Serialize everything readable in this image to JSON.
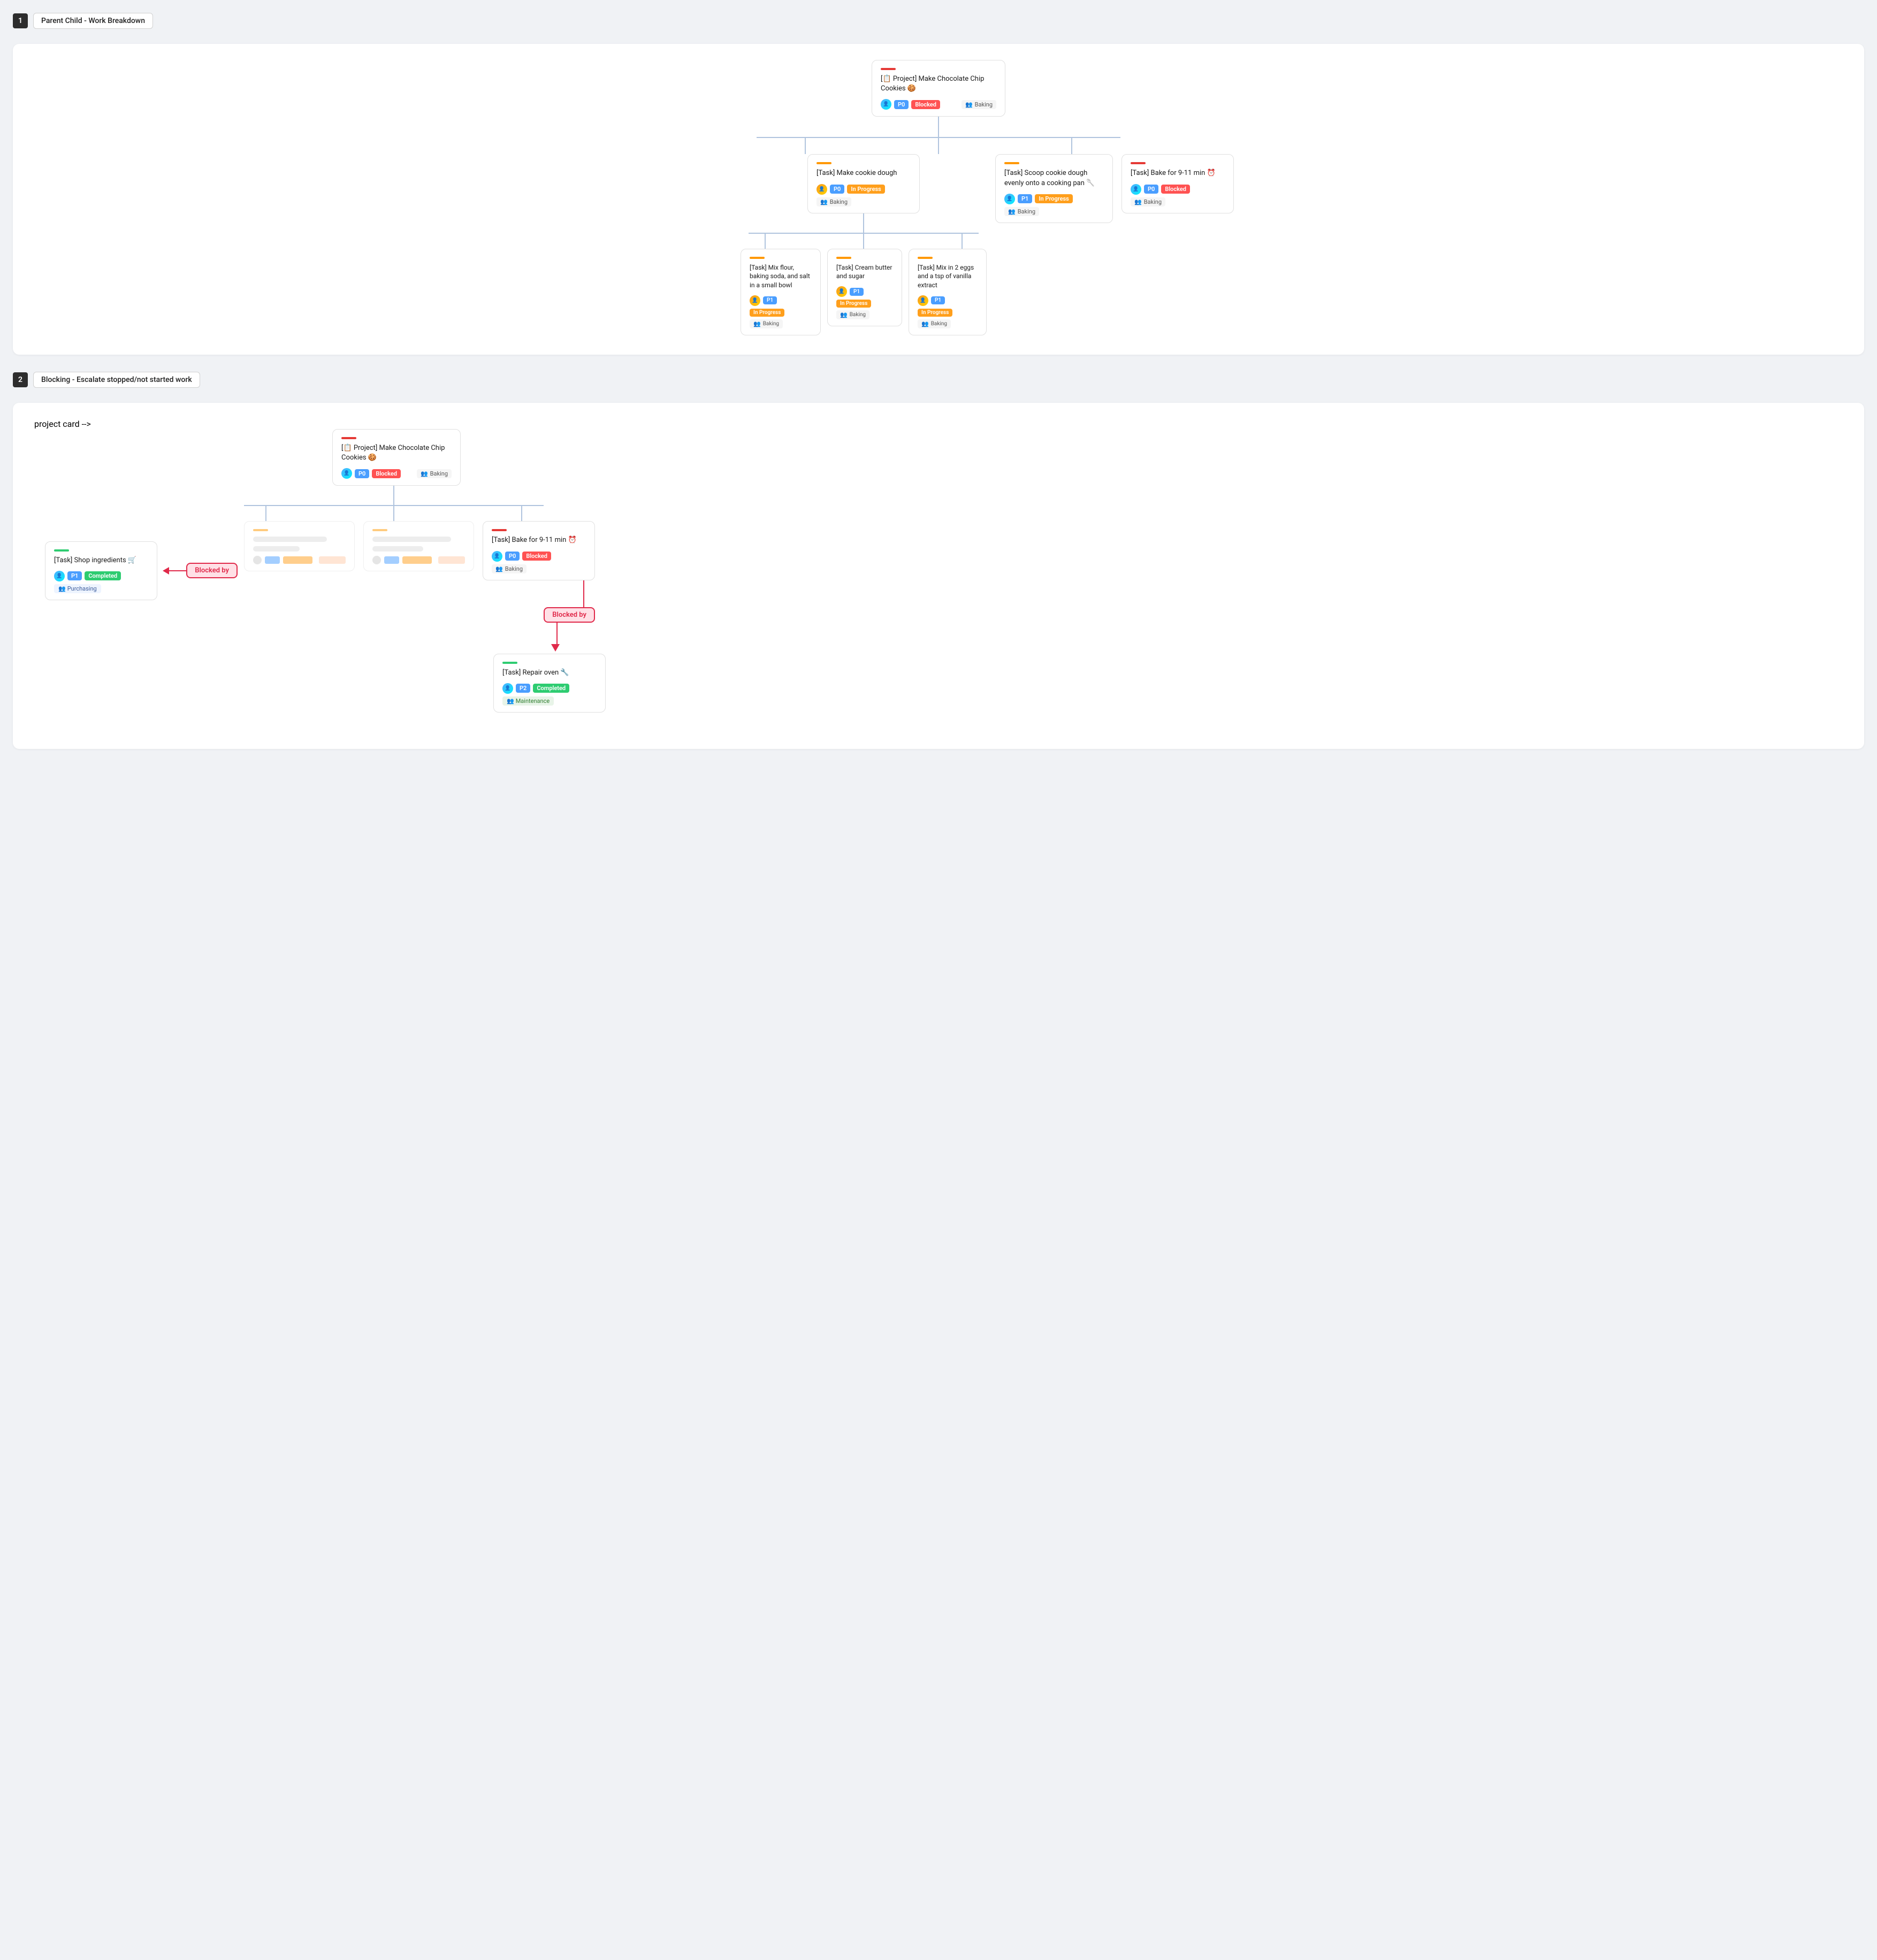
{
  "section1": {
    "number": "1",
    "title": "Parent Child - Work Breakdown",
    "root": {
      "accent": "#e53935",
      "title": "[📋 Project] Make Chocolate Chip Cookies 🍪",
      "avatar": "👤",
      "priority": "P0",
      "status": "Blocked",
      "team": "Baking"
    },
    "level1": [
      {
        "accent": "#ff9800",
        "title": "[Task] Make cookie dough",
        "priority": "P0",
        "status": "In Progress",
        "team": "Baking",
        "hasChildren": true
      },
      {
        "accent": "#ff9800",
        "title": "[Task] Scoop cookie dough evenly onto a cooking pan 🥄",
        "priority": "P1",
        "status": "In Progress",
        "team": "Baking",
        "hasChildren": false
      },
      {
        "accent": "#e53935",
        "title": "[Task] Bake for 9-11 min ⏰",
        "priority": "P0",
        "status": "Blocked",
        "team": "Baking",
        "hasChildren": false
      }
    ],
    "level2": [
      {
        "accent": "#ff9800",
        "title": "[Task] Mix flour, baking soda, and salt in a small bowl",
        "priority": "P1",
        "status": "In Progress",
        "team": "Baking"
      },
      {
        "accent": "#ff9800",
        "title": "[Task] Cream butter and sugar",
        "priority": "P1",
        "status": "In Progress",
        "team": "Baking"
      },
      {
        "accent": "#ff9800",
        "title": "[Task] Mix in 2 eggs and a tsp of vanilla extract",
        "priority": "P1",
        "status": "In Progress",
        "team": "Baking"
      }
    ]
  },
  "section2": {
    "number": "2",
    "title": "Blocking - Escalate stopped/not started work",
    "shopTask": {
      "accent": "#2ecc71",
      "title": "[Task] Shop ingredients 🛒",
      "priority": "P1",
      "status": "Completed",
      "team": "Purchasing"
    },
    "blockedByLabel1": "Blocked by",
    "projectCard": {
      "accent": "#e53935",
      "title": "[📋 Project] Make Chocolate Chip Cookies 🍪",
      "priority": "P0",
      "status": "Blocked",
      "team": "Baking"
    },
    "bakeTask": {
      "accent": "#e53935",
      "title": "[Task] Bake for 9-11 min ⏰",
      "priority": "P0",
      "status": "Blocked",
      "team": "Baking"
    },
    "blockedByLabel2": "Blocked by",
    "repairTask": {
      "accent": "#2ecc71",
      "title": "[Task] Repair oven 🔧",
      "priority": "P2",
      "status": "Completed",
      "team": "Maintenance"
    }
  }
}
